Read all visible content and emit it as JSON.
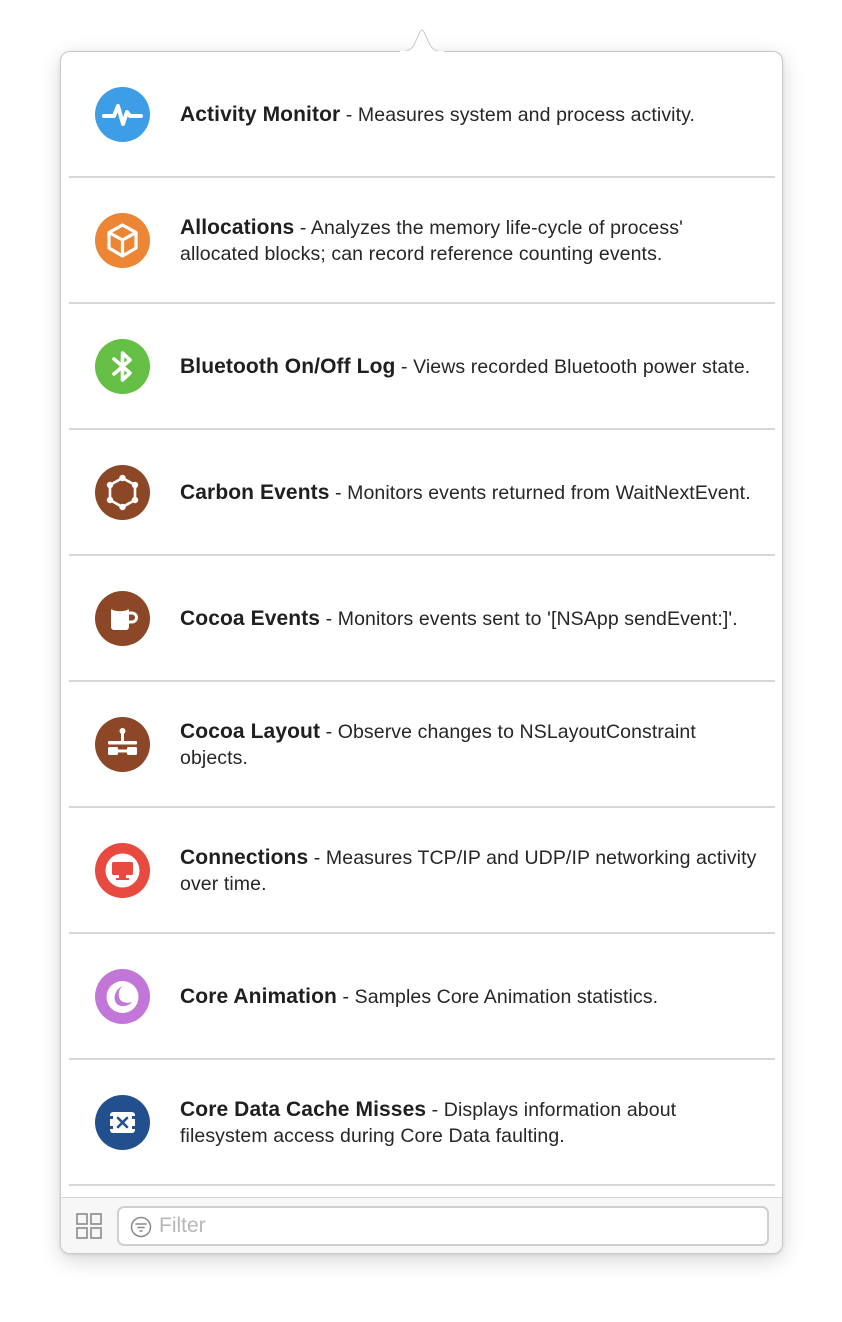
{
  "instruments": [
    {
      "name": "Activity Monitor",
      "description": " - Measures system and process activity.",
      "icon": "activity-pulse-icon",
      "color": "#3d9de6"
    },
    {
      "name": "Allocations",
      "description": " - Analyzes the memory life-cycle of process' allocated blocks; can record reference counting events.",
      "icon": "box-icon",
      "color": "#ec8634"
    },
    {
      "name": "Bluetooth On/Off Log",
      "description": " - Views recorded Bluetooth power state.",
      "icon": "bluetooth-icon",
      "color": "#65bf45"
    },
    {
      "name": "Carbon Events",
      "description": " - Monitors events returned from WaitNextEvent.",
      "icon": "hexagon-nodes-icon",
      "color": "#8b4726"
    },
    {
      "name": "Cocoa Events",
      "description": " - Monitors events sent to '[NSApp sendEvent:]'.",
      "icon": "mug-icon",
      "color": "#8b4726"
    },
    {
      "name": "Cocoa Layout",
      "description": " - Observe changes to NSLayoutConstraint objects.",
      "icon": "layout-constraint-icon",
      "color": "#8b4726"
    },
    {
      "name": "Connections",
      "description": " - Measures TCP/IP and UDP/IP networking activity over time.",
      "icon": "network-monitor-icon",
      "color": "#e94a3f"
    },
    {
      "name": "Core Animation",
      "description": " - Samples Core Animation statistics.",
      "icon": "core-animation-icon",
      "color": "#c277d8"
    },
    {
      "name": "Core Data Cache Misses",
      "description": " - Displays information about filesystem access during Core Data faulting.",
      "icon": "cache-miss-icon",
      "color": "#22508e"
    }
  ],
  "footer": {
    "filter_placeholder": "Filter",
    "filter_value": "",
    "grid_icon": "grid-view-icon",
    "filter_icon": "filter-funnel-icon"
  },
  "colors": {
    "divider": "#d7d7d7",
    "popover_border": "#c9c9c9",
    "footer_background": "#f7f7f7"
  }
}
